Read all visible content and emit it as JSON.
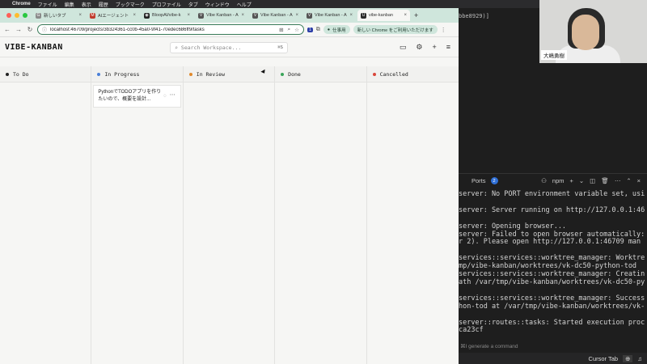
{
  "menubar": {
    "apple": "",
    "items": [
      "Chrome",
      "ファイル",
      "編集",
      "表示",
      "履歴",
      "ブックマーク",
      "プロファイル",
      "タブ",
      "ウィンドウ",
      "ヘルプ"
    ]
  },
  "browser": {
    "tabs": [
      {
        "label": "新しいタブ",
        "fav": "G",
        "fav_color": "#8a8a8a"
      },
      {
        "label": "AIエージェント",
        "fav": "M",
        "fav_color": "#c0392b"
      },
      {
        "label": "BloopAI/vibe-k",
        "fav": "◉",
        "fav_color": "#222222"
      },
      {
        "label": "Vibe Kanban - A",
        "fav": "V",
        "fav_color": "#555555"
      },
      {
        "label": "Vibe Kanban - A",
        "fav": "V",
        "fav_color": "#555555"
      },
      {
        "label": "Vibe Kanban - A",
        "fav": "V",
        "fav_color": "#555555"
      },
      {
        "label": "vibe-kanban",
        "fav": "U",
        "fav_color": "#2b2b2b"
      }
    ],
    "active_tab": 6,
    "tab_close": "×",
    "new_tab": "+",
    "url": "localhost:46709/projects/3b324361-cc0b-45a0-9f41-70edec686ff9/tasks",
    "profile_label": "仕事用",
    "update_label": "新しい Chrome をご利用いただけます"
  },
  "app": {
    "logo": "VIBE-KANBAN",
    "search_placeholder": "Search Workspace...",
    "search_shortcut": "⌘S",
    "columns": [
      {
        "name": "To Do",
        "color": "#222222",
        "cards": []
      },
      {
        "name": "In Progress",
        "color": "#4a7fd8",
        "cards": [
          {
            "title": "PythonでTODOアプリを作りたいので、概要を設計..."
          }
        ]
      },
      {
        "name": "In Review",
        "color": "#e0892b",
        "cards": []
      },
      {
        "name": "Done",
        "color": "#3aa55a",
        "cards": []
      },
      {
        "name": "Cancelled",
        "color": "#d9463b",
        "cards": []
      }
    ]
  },
  "terminal": {
    "top_fragment": "bbe8929)]",
    "ports_label": "Ports",
    "ports_count": "2",
    "npm_label": "npm",
    "lines": [
      "server: No PORT environment variable set, usi",
      "",
      "server: Server running on http://127.0.0.1:46",
      "",
      "server: Opening browser...",
      "server: Failed to open browser automatically:",
      "r 2). Please open http://127.0.0.1:46709 man",
      "",
      "services::services::worktree_manager: Worktre",
      "mp/vibe-kanban/worktrees/vk-dc50-python-tod",
      "services::services::worktree_manager: Creatin",
      "ath /var/tmp/vibe-kanban/worktrees/vk-dc50-py",
      "",
      "services::services::worktree_manager: Success",
      "hon-tod at /var/tmp/vibe-kanban/worktrees/vk-",
      "",
      "server::routes::tasks: Started execution proc",
      "ca23cf"
    ],
    "prompt_hint": "⌘I generate a command",
    "status_cursor_tab": "Cursor Tab"
  },
  "webcam": {
    "name": "大嶋勇樹"
  }
}
